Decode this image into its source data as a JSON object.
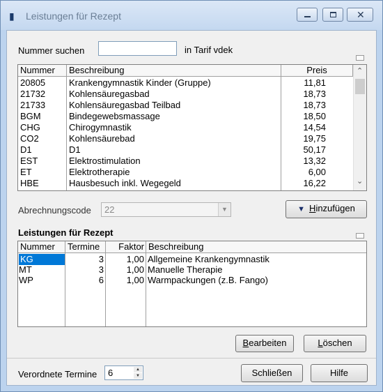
{
  "window": {
    "title": "Leistungen für Rezept"
  },
  "search": {
    "label": "Nummer suchen",
    "value": "",
    "tarif_text": "in Tarif  vdek"
  },
  "catalog": {
    "headers": [
      "Nummer",
      "Beschreibung",
      "Preis"
    ],
    "rows": [
      [
        "20805",
        "Krankengymnastik Kinder (Gruppe)",
        "11,81"
      ],
      [
        "21732",
        "Kohlensäuregasbad",
        "18,73"
      ],
      [
        "21733",
        "Kohlensäuregasbad Teilbad",
        "18,73"
      ],
      [
        "BGM",
        "Bindegewebsmassage",
        "18,50"
      ],
      [
        "CHG",
        "Chirogymnastik",
        "14,54"
      ],
      [
        "CO2",
        "Kohlensäurebad",
        "19,75"
      ],
      [
        "D1",
        "D1",
        "50,17"
      ],
      [
        "EST",
        "Elektrostimulation",
        "13,32"
      ],
      [
        "ET",
        "Elektrotherapie",
        "6,00"
      ],
      [
        "HBE",
        "Hausbesuch inkl. Wegegeld",
        "16,22"
      ]
    ]
  },
  "billing": {
    "label": "Abrechnungscode",
    "value": "22",
    "add_button": "Hinzufügen"
  },
  "prescription": {
    "title": "Leistungen für Rezept",
    "headers": [
      "Nummer",
      "Termine",
      "Faktor",
      "Beschreibung"
    ],
    "rows": [
      [
        "KG",
        "3",
        "1,00",
        "Allgemeine Krankengymnastik"
      ],
      [
        "MT",
        "3",
        "1,00",
        "Manuelle Therapie"
      ],
      [
        "WP",
        "6",
        "1,00",
        "Warmpackungen (z.B. Fango)"
      ]
    ],
    "edit_button": "Bearbeiten",
    "delete_button": "Löschen"
  },
  "footer": {
    "label": "Verordnete Termine",
    "value": "6",
    "close_button": "Schließen",
    "help_button": "Hilfe"
  }
}
